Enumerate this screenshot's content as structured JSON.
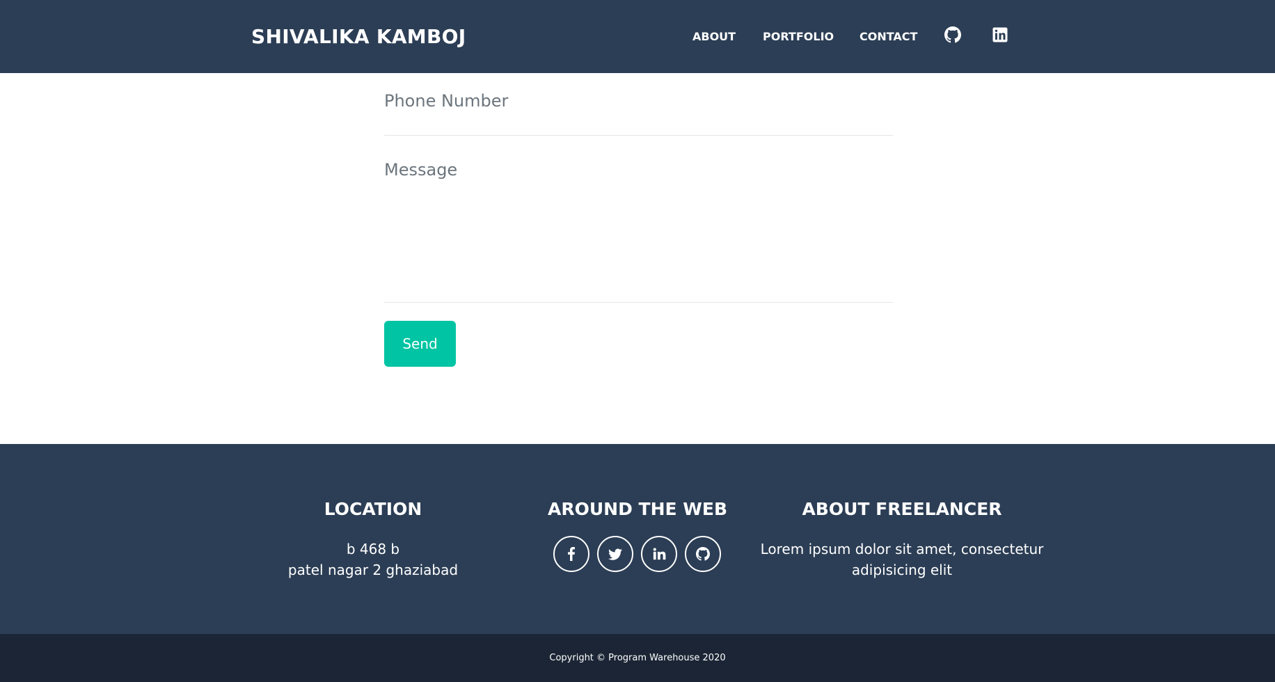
{
  "navbar": {
    "brand": "SHIVALIKA KAMBOJ",
    "links": [
      "ABOUT",
      "PORTFOLIO",
      "CONTACT"
    ],
    "icons": [
      "github-icon",
      "linkedin-icon"
    ]
  },
  "form": {
    "phone_label": "Phone Number",
    "message_label": "Message",
    "send_label": "Send"
  },
  "footer": {
    "location": {
      "heading": "LOCATION",
      "line1": "b 468 b",
      "line2": "patel nagar 2 ghaziabad"
    },
    "web": {
      "heading": "AROUND THE WEB",
      "icons": [
        "facebook-icon",
        "twitter-icon",
        "linkedin-icon",
        "github-icon"
      ]
    },
    "about": {
      "heading": "ABOUT FREELANCER",
      "line1": "Lorem ipsum dolor sit amet, consectetur",
      "line2": "adipisicing elit"
    }
  },
  "copyright": "Copyright © Program Warehouse 2020",
  "colors": {
    "navbar_bg": "#2c3e55",
    "accent": "#00c4a3",
    "copyright_bg": "#1b2535"
  }
}
